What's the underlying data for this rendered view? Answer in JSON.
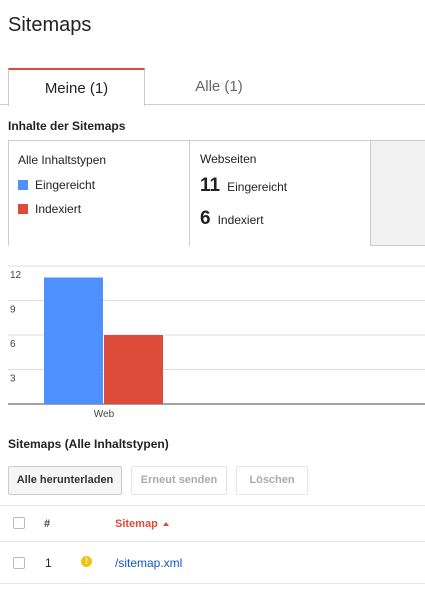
{
  "page": {
    "title": "Sitemaps"
  },
  "tabs": [
    {
      "label": "Meine (1)",
      "active": true
    },
    {
      "label": "Alle (1)",
      "active": false
    }
  ],
  "contents_section": {
    "title": "Inhalte der Sitemaps",
    "types_panel": {
      "header": "Alle Inhaltstypen",
      "legend": [
        {
          "label": "Eingereicht",
          "color": "#4d90fe"
        },
        {
          "label": "Indexiert",
          "color": "#dd4b39"
        }
      ]
    },
    "stats_panel": {
      "header": "Webseiten",
      "submitted": {
        "value": "11",
        "label": "Eingereicht"
      },
      "indexed": {
        "value": "6",
        "label": "Indexiert"
      }
    }
  },
  "chart_data": {
    "type": "bar",
    "categories": [
      "Web"
    ],
    "series": [
      {
        "name": "Eingereicht",
        "values": [
          11
        ],
        "color": "#4d90fe"
      },
      {
        "name": "Indexiert",
        "values": [
          6
        ],
        "color": "#dd4b39"
      }
    ],
    "yticks": [
      3,
      6,
      9,
      12
    ],
    "ylim": [
      0,
      12
    ],
    "grid": true,
    "title": "",
    "xlabel": "",
    "ylabel": ""
  },
  "sitemaps_section": {
    "title": "Sitemaps (Alle Inhaltstypen)",
    "buttons": {
      "download": "Alle herunterladen",
      "resubmit": "Erneut senden",
      "delete": "Löschen"
    },
    "table": {
      "columns": {
        "number": "#",
        "sitemap": "Sitemap"
      },
      "rows": [
        {
          "number": "1",
          "path": "/sitemap.xml",
          "status": "warning",
          "status_glyph": "!"
        }
      ]
    }
  }
}
